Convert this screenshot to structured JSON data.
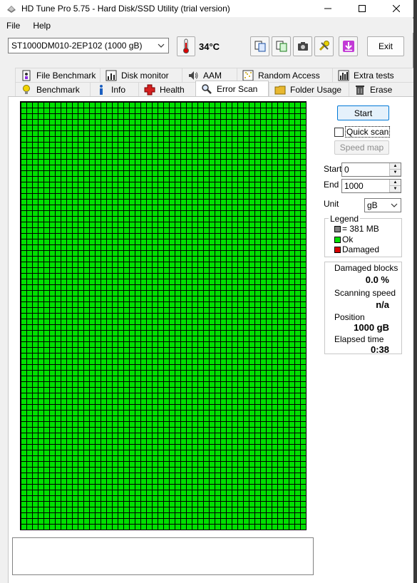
{
  "window": {
    "title": "HD Tune Pro 5.75 - Hard Disk/SSD Utility (trial version)"
  },
  "menu": {
    "file": "File",
    "help": "Help"
  },
  "toolbar": {
    "drive": "ST1000DM010-2EP102 (1000 gB)",
    "temperature": "34°C",
    "exit_label": "Exit"
  },
  "tabs_top": [
    "File Benchmark",
    "Disk monitor",
    "AAM",
    "Random Access",
    "Extra tests"
  ],
  "tabs_bottom": [
    "Benchmark",
    "Info",
    "Health",
    "Error Scan",
    "Folder Usage",
    "Erase"
  ],
  "active_tab": "Error Scan",
  "controls": {
    "start_button": "Start",
    "quick_scan_label": "Quick scan",
    "quick_scan_checked": false,
    "speed_map_button": "Speed map",
    "start_label": "Start",
    "start_value": "0",
    "end_label": "End",
    "end_value": "1000",
    "unit_label": "Unit",
    "unit_value": "gB"
  },
  "legend": {
    "title": "Legend",
    "block_size": "= 381 MB",
    "ok": "Ok",
    "damaged": "Damaged"
  },
  "stats": {
    "damaged_blocks_label": "Damaged blocks",
    "damaged_blocks_value": "0.0 %",
    "scanning_speed_label": "Scanning speed",
    "scanning_speed_value": "n/a",
    "position_label": "Position",
    "position_value": "1000 gB",
    "elapsed_label": "Elapsed time",
    "elapsed_value": "0:38"
  },
  "colors": {
    "ok": "#00e000",
    "damaged": "#d80000",
    "block": "#808080",
    "accent": "#0078d7"
  },
  "scan_progress_fraction": 1.0
}
